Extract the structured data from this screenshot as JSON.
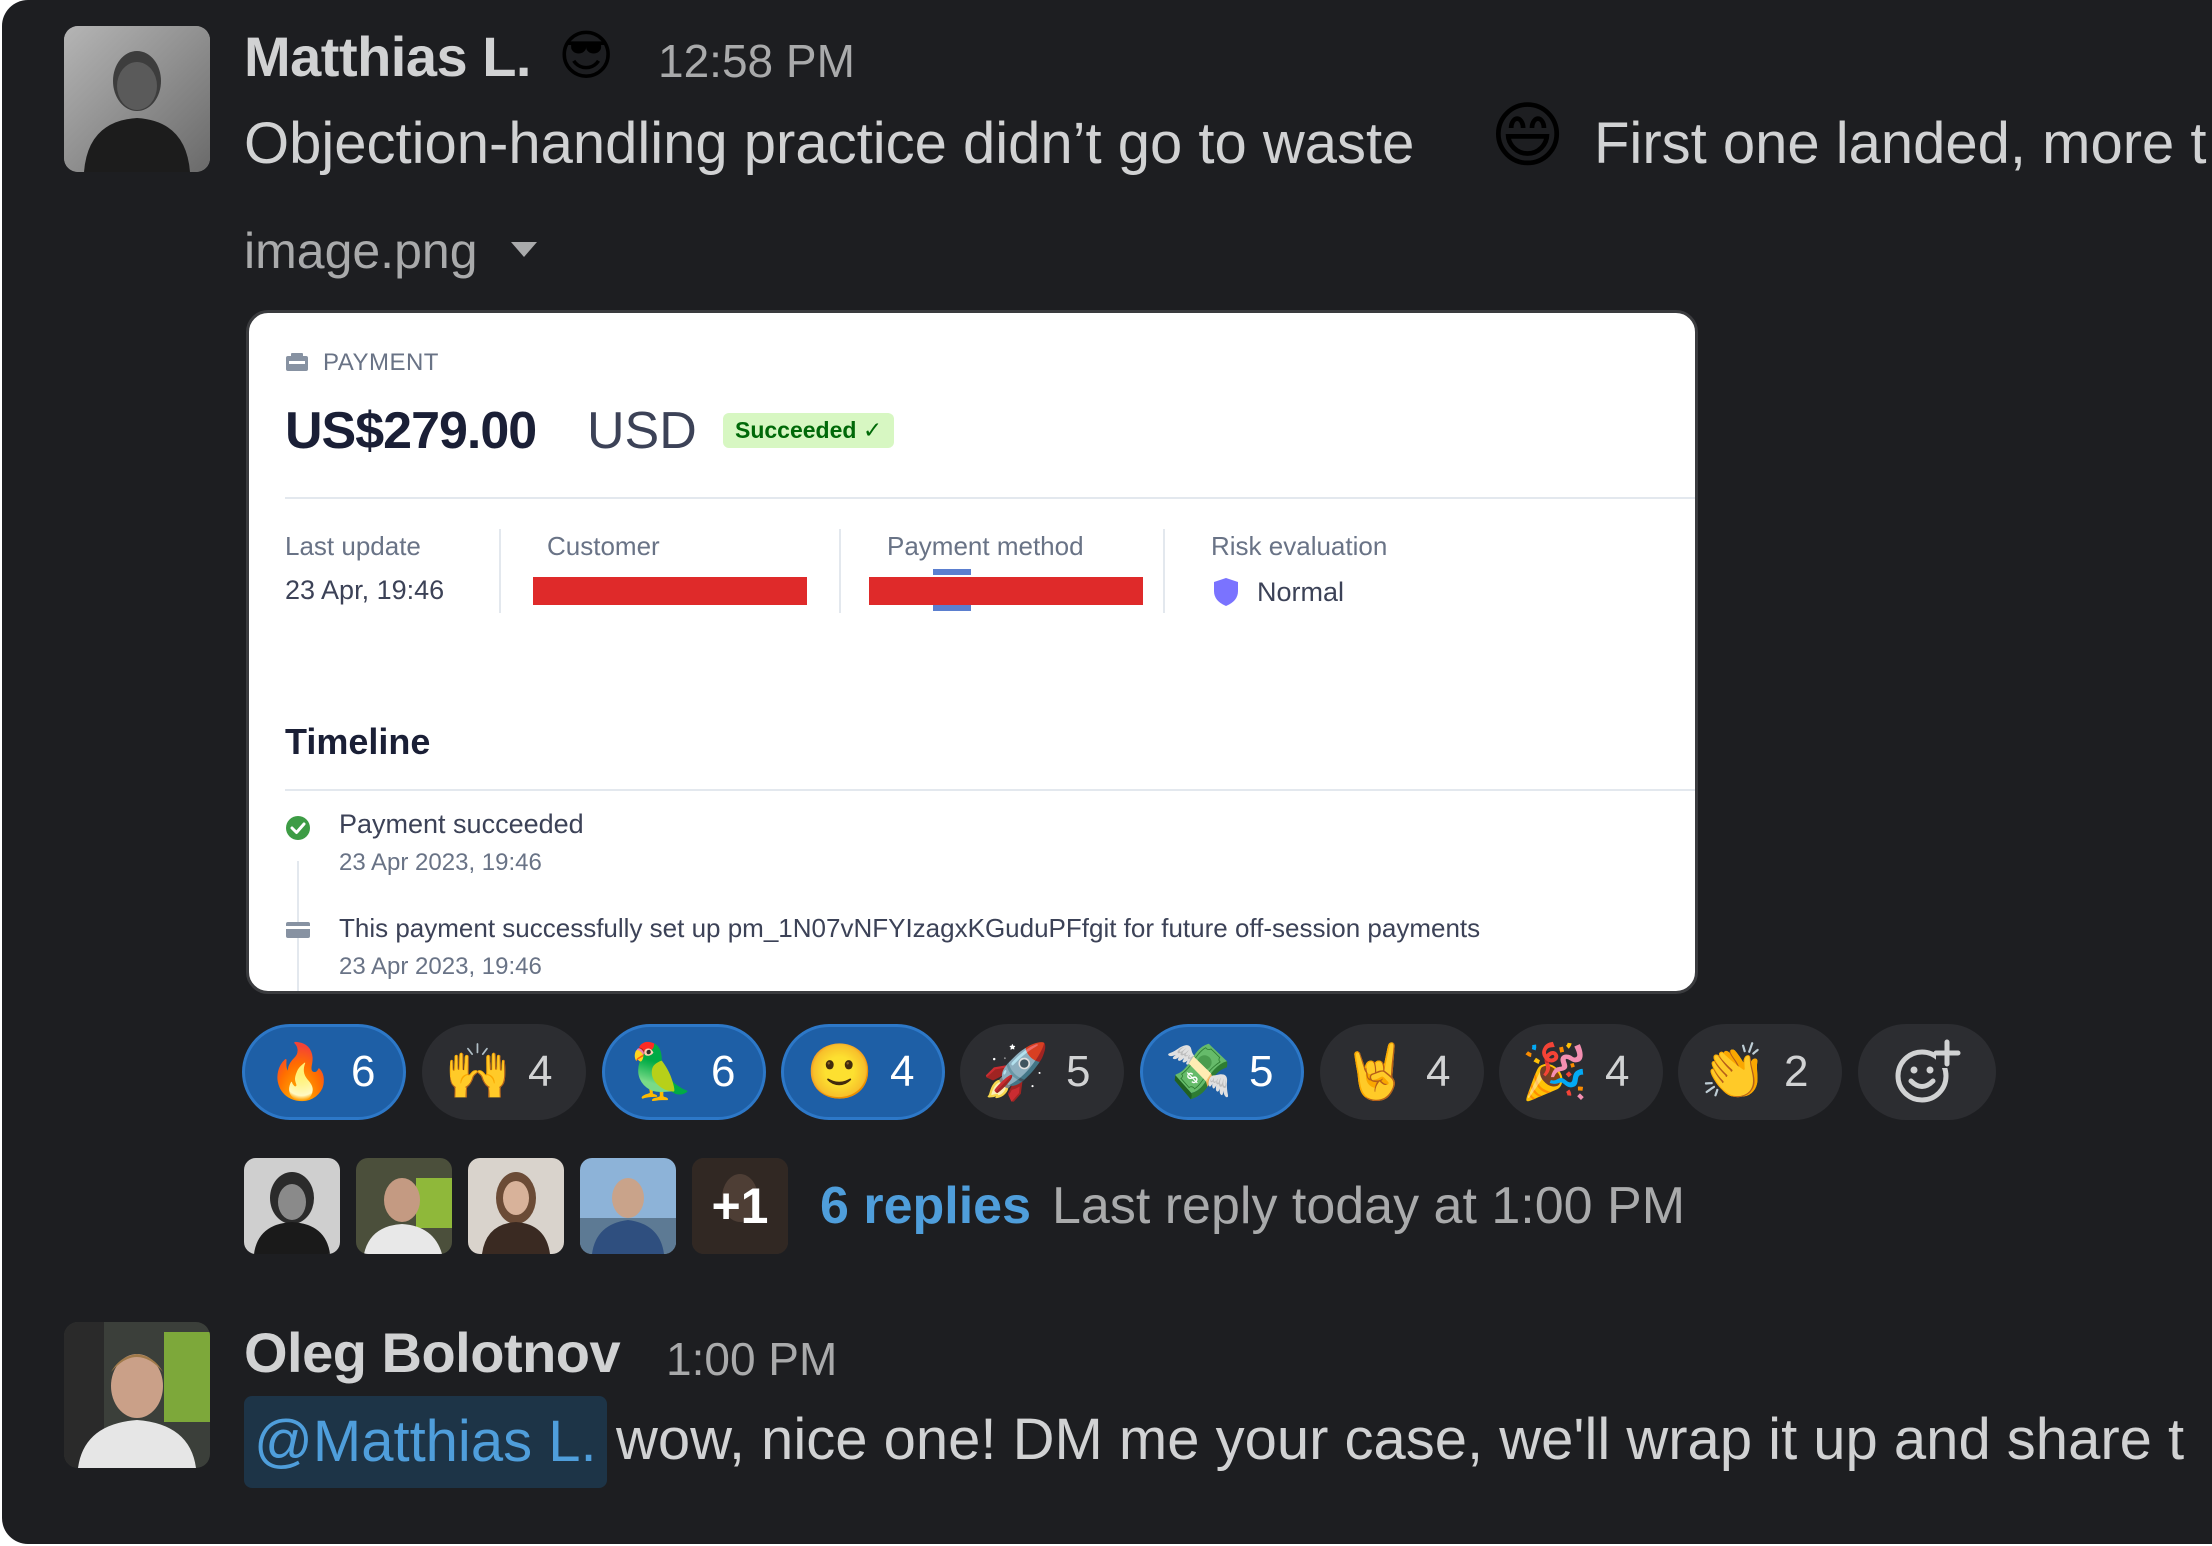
{
  "message1": {
    "author": "Matthias L.",
    "status_emoji": "😎",
    "time": "12:58 PM",
    "text_before": "Objection-handling practice didn’t go to waste",
    "inline_emoji": "😄",
    "text_after": "First one landed, more t",
    "attachment_name": "image.png",
    "card": {
      "section_label": "PAYMENT",
      "amount": "US$279.00",
      "currency": "USD",
      "status": "Succeeded ✓",
      "columns": {
        "last_update_label": "Last update",
        "last_update_value": "23 Apr, 19:46",
        "customer_label": "Customer",
        "payment_method_label": "Payment method",
        "risk_label": "Risk evaluation",
        "risk_value": "Normal"
      },
      "timeline_title": "Timeline",
      "events": [
        {
          "title": "Payment succeeded",
          "date": "23 Apr 2023, 19:46"
        },
        {
          "title": "This payment successfully set up pm_1N07vNFYIzagxKGuduPFfgit for future off-session payments",
          "date": "23 Apr 2023, 19:46"
        }
      ]
    }
  },
  "reactions": [
    {
      "emoji": "🔥",
      "count": "6",
      "active": true
    },
    {
      "emoji": "🙌",
      "count": "4",
      "active": false
    },
    {
      "emoji": "🦜",
      "count": "6",
      "active": true
    },
    {
      "emoji": "🙂",
      "count": "4",
      "active": true
    },
    {
      "emoji": "🚀",
      "count": "5",
      "active": false
    },
    {
      "emoji": "💸",
      "count": "5",
      "active": true
    },
    {
      "emoji": "🤘",
      "count": "4",
      "active": false
    },
    {
      "emoji": "🎉",
      "count": "4",
      "active": false
    },
    {
      "emoji": "👏",
      "count": "2",
      "active": false
    }
  ],
  "thread": {
    "more_count": "+1",
    "replies": "6 replies",
    "last_reply": "Last reply today at 1:00 PM"
  },
  "message2": {
    "author": "Oleg Bolotnov",
    "time": "1:00 PM",
    "mention": "@Matthias L.",
    "text": "wow, nice one! DM me your case, we'll wrap it up and share t"
  },
  "colors": {
    "background": "#1d1e21",
    "link": "#4f9edb",
    "reaction_active": "#1e5fa6",
    "success_badge": "#d7f7c2"
  }
}
